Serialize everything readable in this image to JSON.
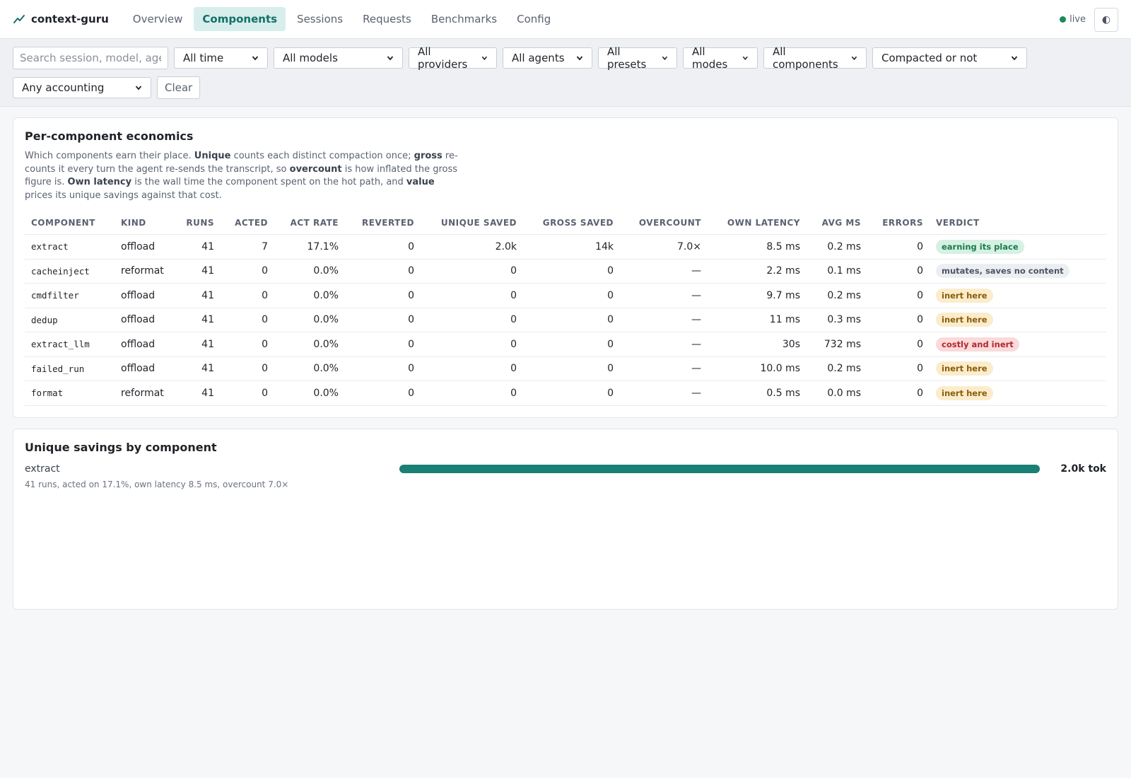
{
  "app": {
    "name": "context-guru"
  },
  "nav": [
    {
      "label": "Overview",
      "active": false
    },
    {
      "label": "Components",
      "active": true
    },
    {
      "label": "Sessions",
      "active": false
    },
    {
      "label": "Requests",
      "active": false
    },
    {
      "label": "Benchmarks",
      "active": false
    },
    {
      "label": "Config",
      "active": false
    }
  ],
  "status": {
    "live_label": "live",
    "theme_icon": "◐"
  },
  "filters": {
    "search_placeholder": "Search session, model, agent",
    "time": "All time",
    "models": "All models",
    "providers": "All providers",
    "agents": "All agents",
    "presets": "All presets",
    "modes": "All modes",
    "components": "All components",
    "compaction": "Compacted or not",
    "accounting": "Any accounting",
    "clear_label": "Clear"
  },
  "economics": {
    "title": "Per-component economics",
    "desc": {
      "p1": "Which components earn their place. ",
      "b1": "Unique",
      "p2": " counts each distinct compaction once; ",
      "b2": "gross",
      "p3": " re-counts it every turn the agent re-sends the transcript, so ",
      "b3": "overcount",
      "p4": " is how inflated the gross figure is. ",
      "b4": "Own latency",
      "p5": " is the wall time the component spent on the hot path, and ",
      "b5": "value",
      "p6": " prices its unique savings against that cost."
    },
    "headers": {
      "component": "COMPONENT",
      "kind": "KIND",
      "runs": "RUNS",
      "acted": "ACTED",
      "act_rate": "ACT RATE",
      "reverted": "REVERTED",
      "unique_saved": "UNIQUE SAVED",
      "gross_saved": "GROSS SAVED",
      "overcount": "OVERCOUNT",
      "own_latency": "OWN LATENCY",
      "avg_ms": "AVG MS",
      "errors": "ERRORS",
      "verdict": "VERDICT"
    },
    "rows": [
      {
        "component": "extract",
        "kind": "offload",
        "runs": "41",
        "acted": "7",
        "act_rate": "17.1%",
        "reverted": "0",
        "unique_saved": "2.0k",
        "gross_saved": "14k",
        "overcount": "7.0×",
        "own_latency": "8.5 ms",
        "avg_ms": "0.2 ms",
        "errors": "0",
        "verdict": "earning its place",
        "verdict_tone": "green"
      },
      {
        "component": "cacheinject",
        "kind": "reformat",
        "runs": "41",
        "acted": "0",
        "act_rate": "0.0%",
        "reverted": "0",
        "unique_saved": "0",
        "gross_saved": "0",
        "overcount": "—",
        "own_latency": "2.2 ms",
        "avg_ms": "0.1 ms",
        "errors": "0",
        "verdict": "mutates, saves no content",
        "verdict_tone": "gray"
      },
      {
        "component": "cmdfilter",
        "kind": "offload",
        "runs": "41",
        "acted": "0",
        "act_rate": "0.0%",
        "reverted": "0",
        "unique_saved": "0",
        "gross_saved": "0",
        "overcount": "—",
        "own_latency": "9.7 ms",
        "avg_ms": "0.2 ms",
        "errors": "0",
        "verdict": "inert here",
        "verdict_tone": "amber"
      },
      {
        "component": "dedup",
        "kind": "offload",
        "runs": "41",
        "acted": "0",
        "act_rate": "0.0%",
        "reverted": "0",
        "unique_saved": "0",
        "gross_saved": "0",
        "overcount": "—",
        "own_latency": "11 ms",
        "avg_ms": "0.3 ms",
        "errors": "0",
        "verdict": "inert here",
        "verdict_tone": "amber"
      },
      {
        "component": "extract_llm",
        "kind": "offload",
        "runs": "41",
        "acted": "0",
        "act_rate": "0.0%",
        "reverted": "0",
        "unique_saved": "0",
        "gross_saved": "0",
        "overcount": "—",
        "own_latency": "30s",
        "avg_ms": "732 ms",
        "errors": "0",
        "verdict": "costly and inert",
        "verdict_tone": "red"
      },
      {
        "component": "failed_run",
        "kind": "offload",
        "runs": "41",
        "acted": "0",
        "act_rate": "0.0%",
        "reverted": "0",
        "unique_saved": "0",
        "gross_saved": "0",
        "overcount": "—",
        "own_latency": "10.0 ms",
        "avg_ms": "0.2 ms",
        "errors": "0",
        "verdict": "inert here",
        "verdict_tone": "amber"
      },
      {
        "component": "format",
        "kind": "reformat",
        "runs": "41",
        "acted": "0",
        "act_rate": "0.0%",
        "reverted": "0",
        "unique_saved": "0",
        "gross_saved": "0",
        "overcount": "—",
        "own_latency": "0.5 ms",
        "avg_ms": "0.0 ms",
        "errors": "0",
        "verdict": "inert here",
        "verdict_tone": "amber"
      }
    ]
  },
  "savings": {
    "title": "Unique savings by component",
    "items": [
      {
        "name": "extract",
        "value_label": "2.0k tok",
        "fraction": 1.0,
        "note": "41 runs, acted on 17.1%, own latency 8.5 ms, overcount 7.0×"
      }
    ]
  },
  "colors": {
    "accent": "#136f68",
    "bar": "#1a7f74",
    "live": "#1a8a5a"
  }
}
